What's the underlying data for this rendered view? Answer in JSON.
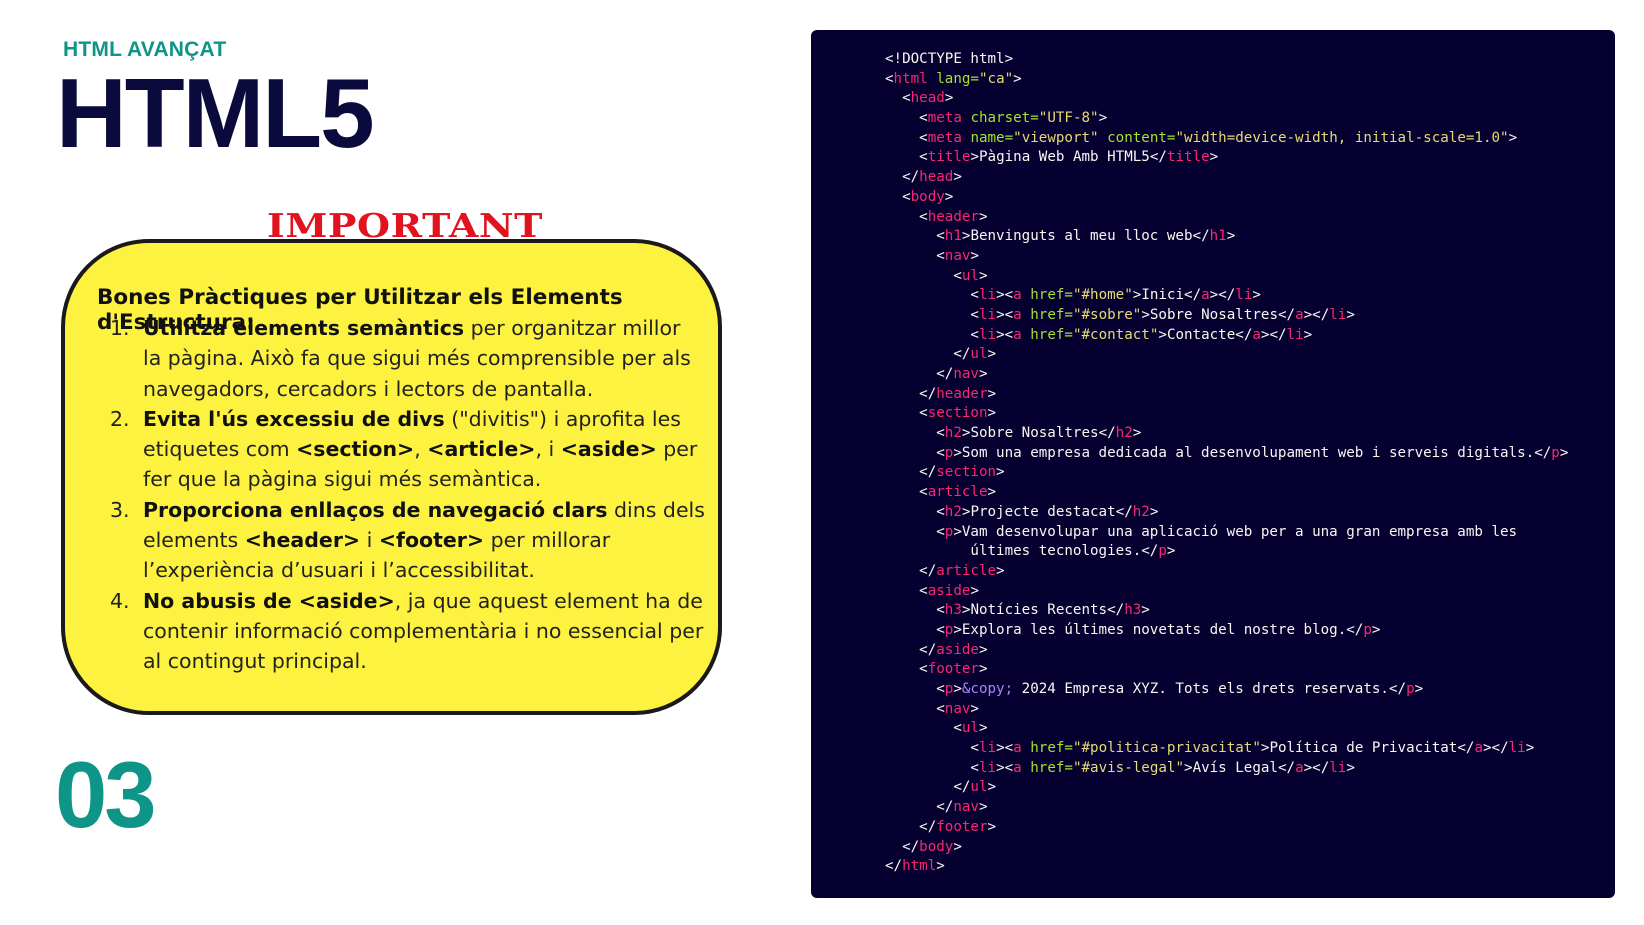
{
  "slide": {
    "kicker": "HTML AVANÇAT",
    "title": "HTML5",
    "important_label": "IMPORTANT",
    "section_number": "03"
  },
  "note": {
    "heading": "Bones Pràctiques per Utilitzar els Elements d'Estructura:",
    "items": [
      {
        "number": "1.",
        "bold": "Utilitza elements semàntics",
        "text": " per organitzar millor la pàgina. Això fa que sigui més comprensible per als navegadors, cercadors i lectors de pantalla."
      },
      {
        "number": "2.",
        "bold": "Evita l'ús excessiu de divs",
        "text_a": " (\"divitis\") i aprofita les etiquetes com ",
        "code1": "<section>",
        "sep1": ", ",
        "code2": "<article>",
        "sep2": ", i ",
        "code3": "<aside>",
        "text_b": " per fer que la pàgina sigui més semàntica."
      },
      {
        "number": "3.",
        "bold": "Proporciona enllaços de navegació clars",
        "text_a": " dins dels elements ",
        "code1": "<header>",
        "sep1": " i ",
        "code2": "<footer>",
        "text_b": " per millorar l’experiència d’usuari i l’accessibilitat."
      },
      {
        "number": "4.",
        "bold": "No abusis de <aside>",
        "text": ", ja que aquest element ha de contenir informació complementària i no essencial per al contingut principal."
      }
    ]
  },
  "code": {
    "colors": {
      "background": "#05002f",
      "tag": "#f92672",
      "attribute": "#a6e22e",
      "string": "#e6db74",
      "text": "#f8f8f2",
      "entity": "#ae81ff"
    },
    "lines": [
      [
        [
          "p",
          "<!DOCTYPE html>"
        ]
      ],
      [
        [
          "p",
          "<"
        ],
        [
          "t",
          "html"
        ],
        [
          "p",
          " "
        ],
        [
          "a",
          "lang="
        ],
        [
          "s",
          "\"ca\""
        ],
        [
          "p",
          ">"
        ]
      ],
      [
        [
          "p",
          "  <"
        ],
        [
          "t",
          "head"
        ],
        [
          "p",
          ">"
        ]
      ],
      [
        [
          "p",
          "    <"
        ],
        [
          "t",
          "meta"
        ],
        [
          "p",
          " "
        ],
        [
          "a",
          "charset="
        ],
        [
          "s",
          "\"UTF-8\""
        ],
        [
          "p",
          ">"
        ]
      ],
      [
        [
          "p",
          "    <"
        ],
        [
          "t",
          "meta"
        ],
        [
          "p",
          " "
        ],
        [
          "a",
          "name="
        ],
        [
          "s",
          "\"viewport\""
        ],
        [
          "p",
          " "
        ],
        [
          "a",
          "content="
        ],
        [
          "s",
          "\"width=device-width, initial-scale=1.0\""
        ],
        [
          "p",
          ">"
        ]
      ],
      [
        [
          "p",
          "    <"
        ],
        [
          "t",
          "title"
        ],
        [
          "p",
          ">"
        ],
        [
          "x",
          "Pàgina Web Amb HTML5"
        ],
        [
          "p",
          "</"
        ],
        [
          "t",
          "title"
        ],
        [
          "p",
          ">"
        ]
      ],
      [
        [
          "p",
          "  </"
        ],
        [
          "t",
          "head"
        ],
        [
          "p",
          ">"
        ]
      ],
      [
        [
          "p",
          "  <"
        ],
        [
          "t",
          "body"
        ],
        [
          "p",
          ">"
        ]
      ],
      [
        [
          "p",
          "    <"
        ],
        [
          "t",
          "header"
        ],
        [
          "p",
          ">"
        ]
      ],
      [
        [
          "p",
          "      <"
        ],
        [
          "t",
          "h1"
        ],
        [
          "p",
          ">"
        ],
        [
          "x",
          "Benvinguts al meu lloc web"
        ],
        [
          "p",
          "</"
        ],
        [
          "t",
          "h1"
        ],
        [
          "p",
          ">"
        ]
      ],
      [
        [
          "p",
          "      <"
        ],
        [
          "t",
          "nav"
        ],
        [
          "p",
          ">"
        ]
      ],
      [
        [
          "p",
          "        <"
        ],
        [
          "t",
          "ul"
        ],
        [
          "p",
          ">"
        ]
      ],
      [
        [
          "p",
          "          <"
        ],
        [
          "t",
          "li"
        ],
        [
          "p",
          "><"
        ],
        [
          "t",
          "a"
        ],
        [
          "p",
          " "
        ],
        [
          "a",
          "href="
        ],
        [
          "s",
          "\"#home\""
        ],
        [
          "p",
          ">"
        ],
        [
          "x",
          "Inici"
        ],
        [
          "p",
          "</"
        ],
        [
          "t",
          "a"
        ],
        [
          "p",
          "></"
        ],
        [
          "t",
          "li"
        ],
        [
          "p",
          ">"
        ]
      ],
      [
        [
          "p",
          "          <"
        ],
        [
          "t",
          "li"
        ],
        [
          "p",
          "><"
        ],
        [
          "t",
          "a"
        ],
        [
          "p",
          " "
        ],
        [
          "a",
          "href="
        ],
        [
          "s",
          "\"#sobre\""
        ],
        [
          "p",
          ">"
        ],
        [
          "x",
          "Sobre Nosaltres"
        ],
        [
          "p",
          "</"
        ],
        [
          "t",
          "a"
        ],
        [
          "p",
          "></"
        ],
        [
          "t",
          "li"
        ],
        [
          "p",
          ">"
        ]
      ],
      [
        [
          "p",
          "          <"
        ],
        [
          "t",
          "li"
        ],
        [
          "p",
          "><"
        ],
        [
          "t",
          "a"
        ],
        [
          "p",
          " "
        ],
        [
          "a",
          "href="
        ],
        [
          "s",
          "\"#contact\""
        ],
        [
          "p",
          ">"
        ],
        [
          "x",
          "Contacte"
        ],
        [
          "p",
          "</"
        ],
        [
          "t",
          "a"
        ],
        [
          "p",
          "></"
        ],
        [
          "t",
          "li"
        ],
        [
          "p",
          ">"
        ]
      ],
      [
        [
          "p",
          "        </"
        ],
        [
          "t",
          "ul"
        ],
        [
          "p",
          ">"
        ]
      ],
      [
        [
          "p",
          "      </"
        ],
        [
          "t",
          "nav"
        ],
        [
          "p",
          ">"
        ]
      ],
      [
        [
          "p",
          "    </"
        ],
        [
          "t",
          "header"
        ],
        [
          "p",
          ">"
        ]
      ],
      [
        [
          "p",
          "    <"
        ],
        [
          "t",
          "section"
        ],
        [
          "p",
          ">"
        ]
      ],
      [
        [
          "p",
          "      <"
        ],
        [
          "t",
          "h2"
        ],
        [
          "p",
          ">"
        ],
        [
          "x",
          "Sobre Nosaltres"
        ],
        [
          "p",
          "</"
        ],
        [
          "t",
          "h2"
        ],
        [
          "p",
          ">"
        ]
      ],
      [
        [
          "p",
          "      <"
        ],
        [
          "t",
          "p"
        ],
        [
          "p",
          ">"
        ],
        [
          "x",
          "Som una empresa dedicada al desenvolupament web i serveis digitals."
        ],
        [
          "p",
          "</"
        ],
        [
          "t",
          "p"
        ],
        [
          "p",
          ">"
        ]
      ],
      [
        [
          "p",
          "    </"
        ],
        [
          "t",
          "section"
        ],
        [
          "p",
          ">"
        ]
      ],
      [
        [
          "p",
          "    <"
        ],
        [
          "t",
          "article"
        ],
        [
          "p",
          ">"
        ]
      ],
      [
        [
          "p",
          "      <"
        ],
        [
          "t",
          "h2"
        ],
        [
          "p",
          ">"
        ],
        [
          "x",
          "Projecte destacat"
        ],
        [
          "p",
          "</"
        ],
        [
          "t",
          "h2"
        ],
        [
          "p",
          ">"
        ]
      ],
      [
        [
          "p",
          "      <"
        ],
        [
          "t",
          "p"
        ],
        [
          "p",
          ">"
        ],
        [
          "x",
          "Vam desenvolupar una aplicació web per a una gran empresa amb les"
        ]
      ],
      [
        [
          "x",
          "          últimes tecnologies."
        ],
        [
          "p",
          "</"
        ],
        [
          "t",
          "p"
        ],
        [
          "p",
          ">"
        ]
      ],
      [
        [
          "p",
          "    </"
        ],
        [
          "t",
          "article"
        ],
        [
          "p",
          ">"
        ]
      ],
      [
        [
          "p",
          "    <"
        ],
        [
          "t",
          "aside"
        ],
        [
          "p",
          ">"
        ]
      ],
      [
        [
          "p",
          "      <"
        ],
        [
          "t",
          "h3"
        ],
        [
          "p",
          ">"
        ],
        [
          "x",
          "Notícies Recents"
        ],
        [
          "p",
          "</"
        ],
        [
          "t",
          "h3"
        ],
        [
          "p",
          ">"
        ]
      ],
      [
        [
          "p",
          "      <"
        ],
        [
          "t",
          "p"
        ],
        [
          "p",
          ">"
        ],
        [
          "x",
          "Explora les últimes novetats del nostre blog."
        ],
        [
          "p",
          "</"
        ],
        [
          "t",
          "p"
        ],
        [
          "p",
          ">"
        ]
      ],
      [
        [
          "p",
          "    </"
        ],
        [
          "t",
          "aside"
        ],
        [
          "p",
          ">"
        ]
      ],
      [
        [
          "p",
          "    <"
        ],
        [
          "t",
          "footer"
        ],
        [
          "p",
          ">"
        ]
      ],
      [
        [
          "p",
          "      <"
        ],
        [
          "t",
          "p"
        ],
        [
          "p",
          ">"
        ],
        [
          "e",
          "&copy;"
        ],
        [
          "x",
          " 2024 Empresa XYZ. Tots els drets reservats."
        ],
        [
          "p",
          "</"
        ],
        [
          "t",
          "p"
        ],
        [
          "p",
          ">"
        ]
      ],
      [
        [
          "p",
          "      <"
        ],
        [
          "t",
          "nav"
        ],
        [
          "p",
          ">"
        ]
      ],
      [
        [
          "p",
          "        <"
        ],
        [
          "t",
          "ul"
        ],
        [
          "p",
          ">"
        ]
      ],
      [
        [
          "p",
          "          <"
        ],
        [
          "t",
          "li"
        ],
        [
          "p",
          "><"
        ],
        [
          "t",
          "a"
        ],
        [
          "p",
          " "
        ],
        [
          "a",
          "href="
        ],
        [
          "s",
          "\"#politica-privacitat\""
        ],
        [
          "p",
          ">"
        ],
        [
          "x",
          "Política de Privacitat"
        ],
        [
          "p",
          "</"
        ],
        [
          "t",
          "a"
        ],
        [
          "p",
          "></"
        ],
        [
          "t",
          "li"
        ],
        [
          "p",
          ">"
        ]
      ],
      [
        [
          "p",
          "          <"
        ],
        [
          "t",
          "li"
        ],
        [
          "p",
          "><"
        ],
        [
          "t",
          "a"
        ],
        [
          "p",
          " "
        ],
        [
          "a",
          "href="
        ],
        [
          "s",
          "\"#avis-legal\""
        ],
        [
          "p",
          ">"
        ],
        [
          "x",
          "Avís Legal"
        ],
        [
          "p",
          "</"
        ],
        [
          "t",
          "a"
        ],
        [
          "p",
          "></"
        ],
        [
          "t",
          "li"
        ],
        [
          "p",
          ">"
        ]
      ],
      [
        [
          "p",
          "        </"
        ],
        [
          "t",
          "ul"
        ],
        [
          "p",
          ">"
        ]
      ],
      [
        [
          "p",
          "      </"
        ],
        [
          "t",
          "nav"
        ],
        [
          "p",
          ">"
        ]
      ],
      [
        [
          "p",
          "    </"
        ],
        [
          "t",
          "footer"
        ],
        [
          "p",
          ">"
        ]
      ],
      [
        [
          "p",
          "  </"
        ],
        [
          "t",
          "body"
        ],
        [
          "p",
          ">"
        ]
      ],
      [
        [
          "p",
          "</"
        ],
        [
          "t",
          "html"
        ],
        [
          "p",
          ">"
        ]
      ]
    ]
  }
}
